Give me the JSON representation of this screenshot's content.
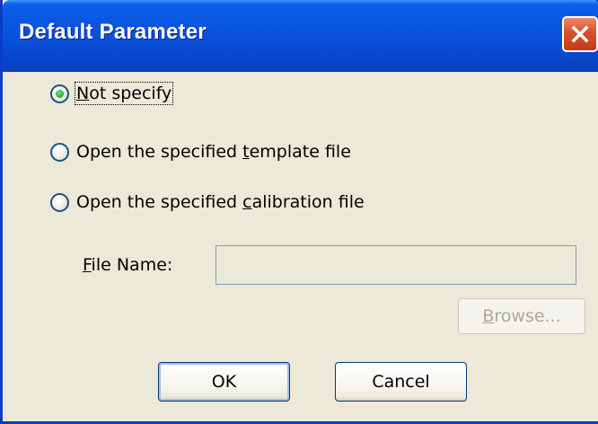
{
  "dialog": {
    "title": "Default Parameter",
    "close_icon": "close-icon",
    "accent_color": "#0a54df"
  },
  "options": [
    {
      "label": "Not specify",
      "selected": true
    },
    {
      "label": "Open the specified template file",
      "selected": false
    },
    {
      "label": "Open the specified calibration file",
      "selected": false
    }
  ],
  "file": {
    "label": "File Name:",
    "value": ""
  },
  "buttons": {
    "browse": "Browse...",
    "ok": "OK",
    "cancel": "Cancel"
  }
}
